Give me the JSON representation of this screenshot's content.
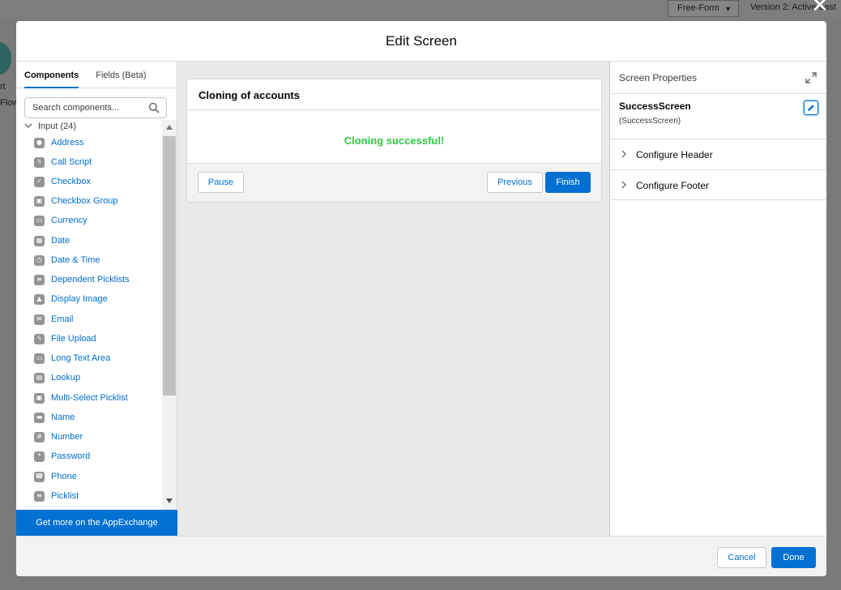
{
  "background": {
    "mode_select": "Free-Form",
    "version": "Version 2: Active-Last",
    "snippet_1": "rt",
    "snippet_2": "Flow"
  },
  "modal": {
    "title": "Edit Screen",
    "close": "✕"
  },
  "left_panel": {
    "tabs": [
      "Components",
      "Fields (Beta)"
    ],
    "search_placeholder": "Search components...",
    "section_label": "Input (24)",
    "items": [
      {
        "label": "Address",
        "icon": "map-pin-icon"
      },
      {
        "label": "Call Script",
        "icon": "lightning-icon"
      },
      {
        "label": "Checkbox",
        "icon": "checkbox-icon"
      },
      {
        "label": "Checkbox Group",
        "icon": "checkbox-group-icon"
      },
      {
        "label": "Currency",
        "icon": "currency-icon"
      },
      {
        "label": "Date",
        "icon": "calendar-icon"
      },
      {
        "label": "Date & Time",
        "icon": "date-time-icon"
      },
      {
        "label": "Dependent Picklists",
        "icon": "list-icon"
      },
      {
        "label": "Display Image",
        "icon": "image-icon"
      },
      {
        "label": "Email",
        "icon": "email-icon"
      },
      {
        "label": "File Upload",
        "icon": "lightning-icon"
      },
      {
        "label": "Long Text Area",
        "icon": "textarea-icon"
      },
      {
        "label": "Lookup",
        "icon": "lookup-icon"
      },
      {
        "label": "Multi-Select Picklist",
        "icon": "multi-select-icon"
      },
      {
        "label": "Name",
        "icon": "name-card-icon"
      },
      {
        "label": "Number",
        "icon": "number-icon"
      },
      {
        "label": "Password",
        "icon": "password-icon"
      },
      {
        "label": "Phone",
        "icon": "phone-icon"
      },
      {
        "label": "Picklist",
        "icon": "list-icon"
      }
    ],
    "appexchange_link": "Get more on the AppExchange"
  },
  "canvas": {
    "screen_title": "Cloning of accounts",
    "message": "Cloning successful!",
    "pause_label": "Pause",
    "previous_label": "Previous",
    "finish_label": "Finish",
    "message_color": "#2ecc40"
  },
  "right_panel": {
    "heading": "Screen Properties",
    "screen_name": "SuccessScreen",
    "screen_api_name": "(SuccessScreen)",
    "sections": [
      "Configure Header",
      "Configure Footer"
    ]
  },
  "footer": {
    "cancel_label": "Cancel",
    "done_label": "Done"
  },
  "colors": {
    "brand": "#0070d2",
    "link": "#006dcc"
  }
}
